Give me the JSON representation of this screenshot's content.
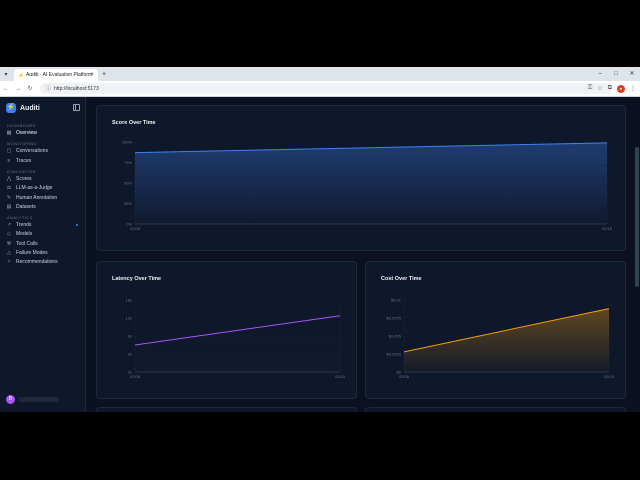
{
  "browser": {
    "tab_title": "Auditi - AI Evaluation Platform",
    "url": "http://localhost:5173"
  },
  "app": {
    "brand": "Auditi",
    "user_initial": "B"
  },
  "sidebar": {
    "sections": [
      {
        "label": "DASHBOARD",
        "items": [
          {
            "label": "Overview",
            "icon": "grid-icon",
            "active": true
          }
        ]
      },
      {
        "label": "MONITORING",
        "items": [
          {
            "label": "Conversations",
            "icon": "chat-icon"
          },
          {
            "label": "Traces",
            "icon": "list-icon"
          }
        ]
      },
      {
        "label": "EVALUATION",
        "items": [
          {
            "label": "Scores",
            "icon": "chart-icon"
          },
          {
            "label": "LLM-as-a-Judge",
            "icon": "gavel-icon"
          },
          {
            "label": "Human Annotation",
            "icon": "edit-icon"
          },
          {
            "label": "Datasets",
            "icon": "database-icon"
          }
        ]
      },
      {
        "label": "ANALYTICS",
        "items": [
          {
            "label": "Trends",
            "icon": "trend-icon"
          },
          {
            "label": "Models",
            "icon": "cube-icon"
          },
          {
            "label": "Tool Calls",
            "icon": "wrench-icon"
          },
          {
            "label": "Failure Modes",
            "icon": "alert-icon"
          },
          {
            "label": "Recommendations",
            "icon": "lightbulb-icon"
          }
        ]
      }
    ]
  },
  "charts": {
    "score": {
      "title": "Score Over Time"
    },
    "latency": {
      "title": "Latency Over Time"
    },
    "cost": {
      "title": "Cost Over Time"
    }
  },
  "chart_data": [
    {
      "type": "area",
      "title": "Score Over Time",
      "x": [
        "02/08",
        "02/15"
      ],
      "series": [
        {
          "values": [
            87,
            99
          ]
        }
      ],
      "yticks": [
        "0%",
        "25%",
        "50%",
        "75%",
        "100%"
      ],
      "ylim": [
        0,
        100
      ],
      "color": "#3b82f6"
    },
    {
      "type": "line",
      "title": "Latency Over Time",
      "x": [
        "02/08",
        "02/15"
      ],
      "series": [
        {
          "values": [
            6,
            12.5
          ]
        }
      ],
      "yticks": [
        "0s",
        "4s",
        "8s",
        "12s",
        "16s"
      ],
      "ylim": [
        0,
        16
      ],
      "color": "#a855f7"
    },
    {
      "type": "area",
      "title": "Cost Over Time",
      "x": [
        "02/08",
        "02/15"
      ],
      "series": [
        {
          "values": [
            0.0028,
            0.0088
          ]
        }
      ],
      "yticks": [
        "$0",
        "$0.0025",
        "$0.005",
        "$0.0075",
        "$0.01"
      ],
      "ylim": [
        0,
        0.01
      ],
      "color": "#f59e0b"
    }
  ]
}
